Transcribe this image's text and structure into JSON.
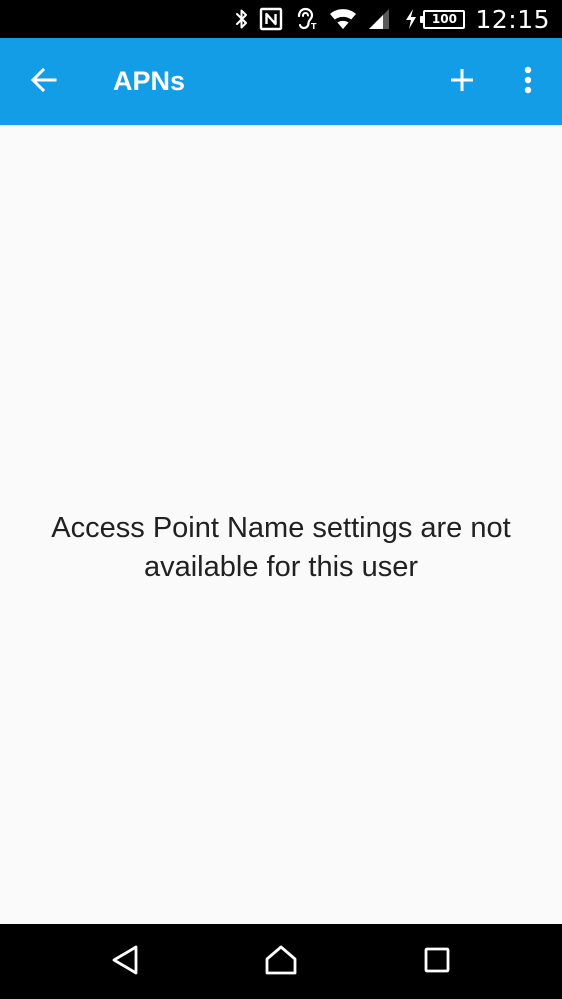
{
  "status_bar": {
    "icons": [
      "bluetooth-icon",
      "nfc-icon",
      "hearing-aid-icon",
      "wifi-icon",
      "signal-icon",
      "charging-icon"
    ],
    "battery_level": "100",
    "time": "12:15"
  },
  "app_bar": {
    "title": "APNs",
    "color": "#139de7",
    "back_icon": "arrow-left-icon",
    "add_icon": "plus-icon",
    "overflow_icon": "more-vertical-icon"
  },
  "content": {
    "message": "Access Point Name settings are not available for this user"
  },
  "nav_bar": {
    "icons": [
      "triangle-back-icon",
      "home-outline-icon",
      "square-recents-icon"
    ]
  }
}
